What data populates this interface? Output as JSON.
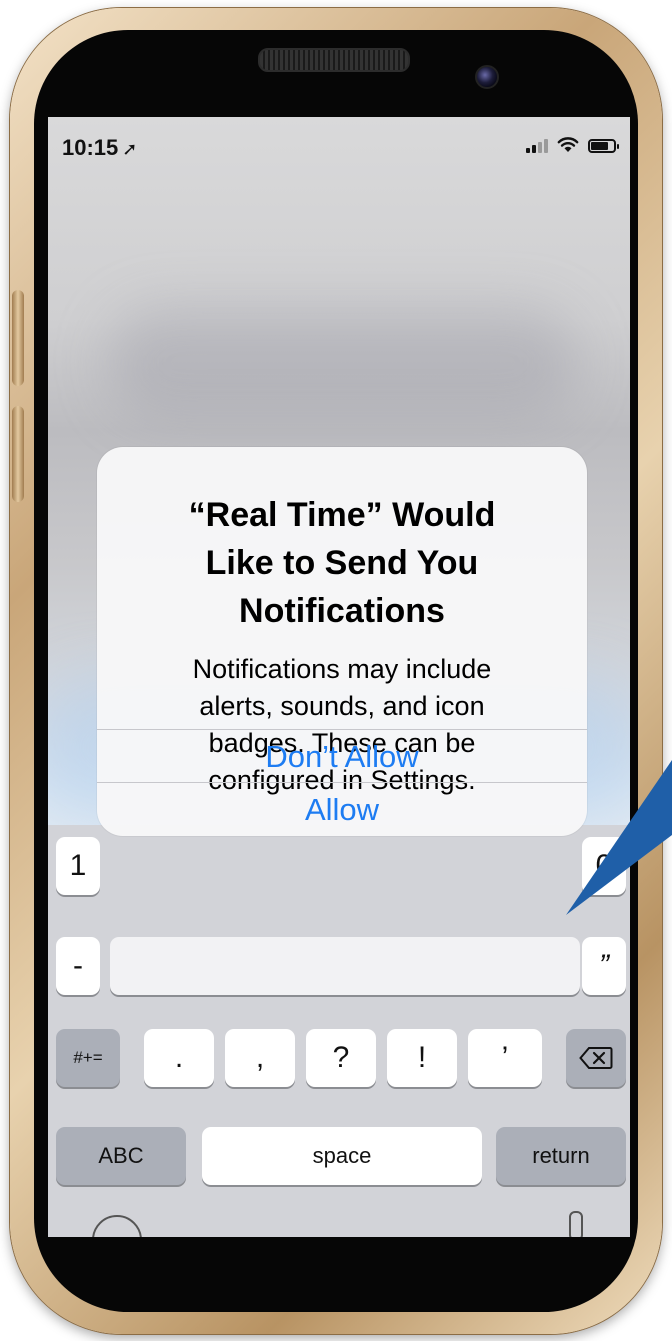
{
  "status_bar": {
    "time": "10:15",
    "location_icon": "location-arrow-icon",
    "signal_icon": "cellular-signal-icon",
    "wifi_icon": "wifi-icon",
    "battery_icon": "battery-icon"
  },
  "alert": {
    "title": "“Real Time” Would\nLike to Send You\nNotifications",
    "message": "Notifications may include\nalerts, sounds, and icon\nbadges. These can be\nconfigured in Settings.",
    "dont_allow_label": "Don’t Allow",
    "allow_label": "Allow"
  },
  "keyboard": {
    "row1_visible": [
      "1",
      "0"
    ],
    "row2_visible": [
      "-",
      "”"
    ],
    "row3": [
      "#+=",
      ".",
      ",",
      "?",
      "!",
      "’"
    ],
    "delete_icon": "delete-backspace-icon",
    "abc_label": "ABC",
    "space_label": "space",
    "return_label": "return"
  },
  "colors": {
    "accent": "#1d7cf2",
    "frame_gold": "#c9a679",
    "callout": "#1f5fa8"
  }
}
